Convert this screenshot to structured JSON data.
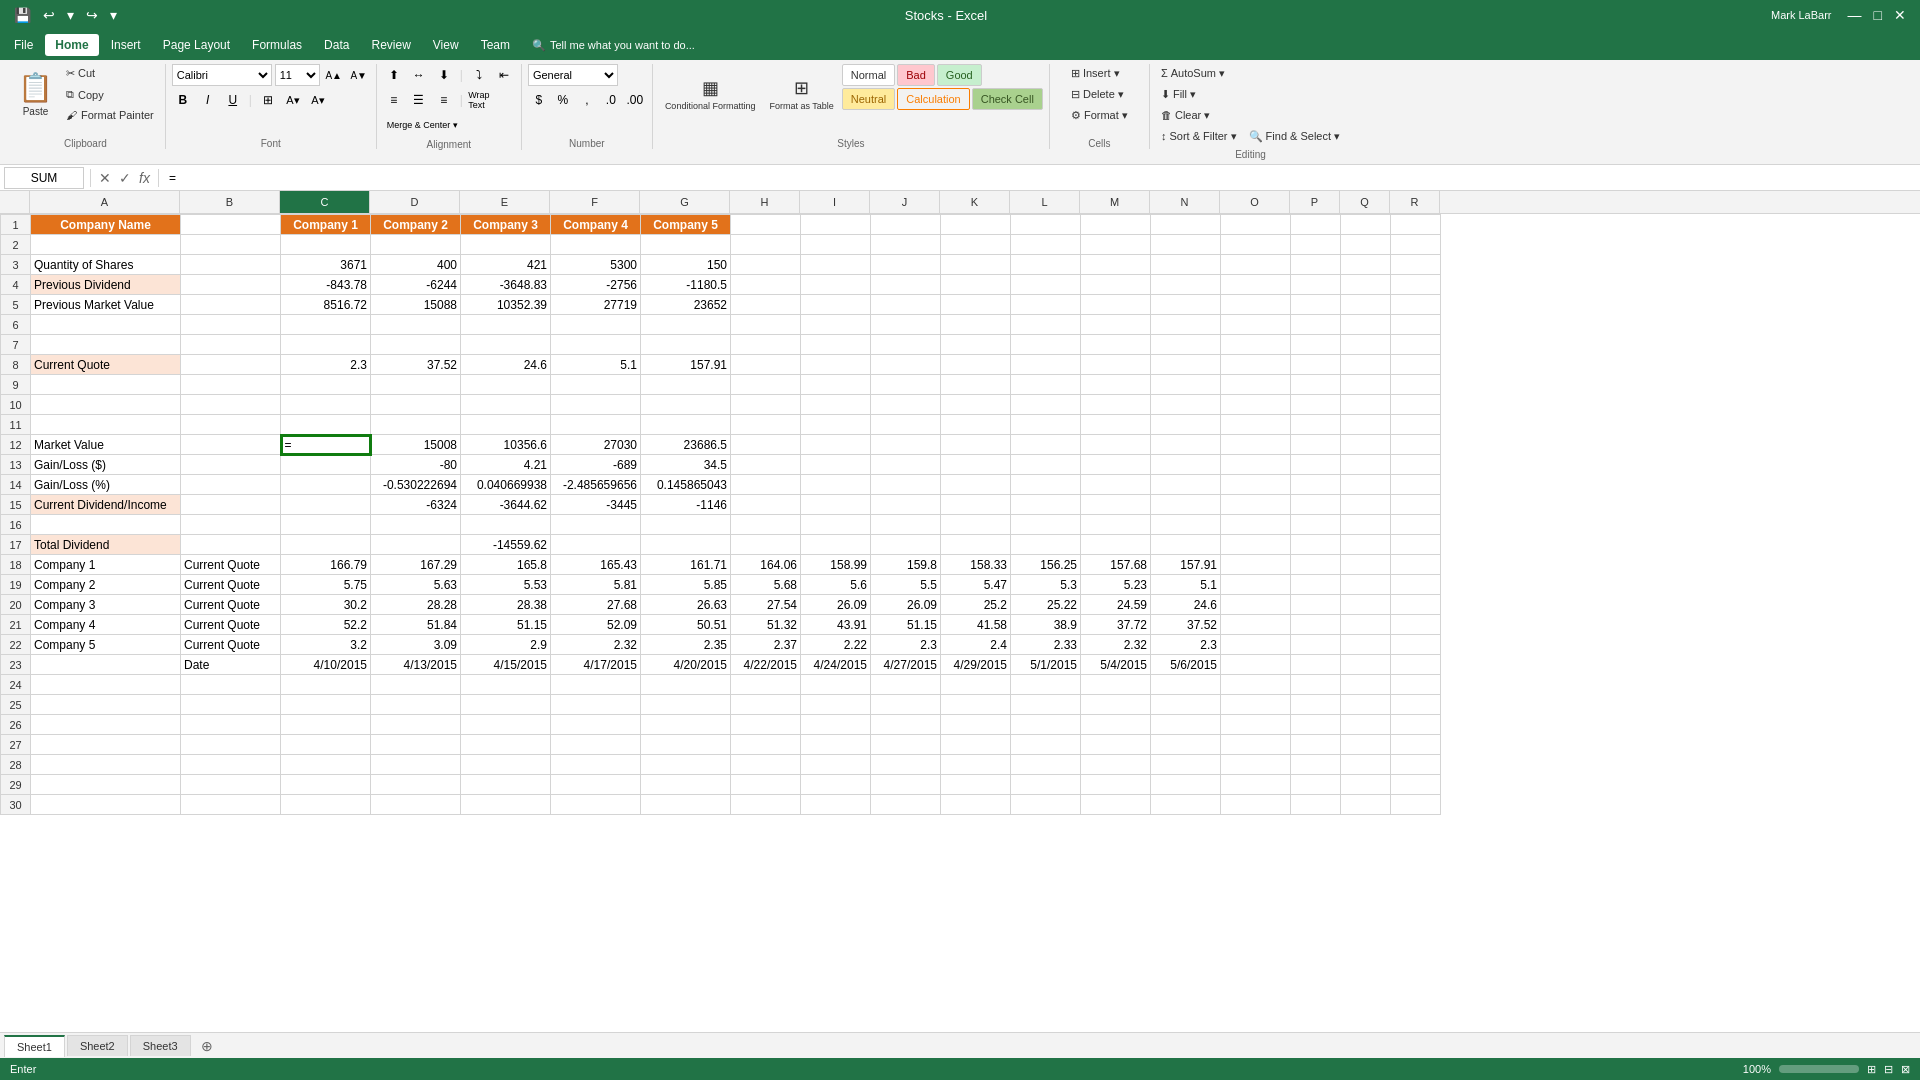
{
  "app": {
    "title": "Stocks - Excel",
    "user": "Mark LaBarr"
  },
  "titlebar": {
    "save_icon": "💾",
    "undo_icon": "↩",
    "redo_icon": "↪",
    "minimize": "—",
    "maximize": "□",
    "close": "✕"
  },
  "menu": {
    "items": [
      "File",
      "Home",
      "Insert",
      "Page Layout",
      "Formulas",
      "Data",
      "Review",
      "View",
      "Team"
    ]
  },
  "ribbon": {
    "clipboard": {
      "label": "Clipboard",
      "paste_label": "Paste",
      "cut_label": "Cut",
      "copy_label": "Copy",
      "format_painter_label": "Format Painter"
    },
    "font": {
      "label": "Font",
      "font_name": "Calibri",
      "font_size": "11",
      "bold": "B",
      "italic": "I",
      "underline": "U"
    },
    "alignment": {
      "label": "Alignment",
      "wrap_text": "Wrap Text",
      "merge_center": "Merge & Center"
    },
    "number": {
      "label": "Number",
      "format": "General"
    },
    "styles": {
      "label": "Styles",
      "conditional_formatting": "Conditional Formatting",
      "format_as_table": "Format as Table",
      "normal": "Normal",
      "bad": "Bad",
      "good": "Good",
      "neutral": "Neutral",
      "calculation": "Calculation",
      "check_cell": "Check Cell"
    },
    "cells": {
      "label": "Cells",
      "insert": "Insert",
      "delete": "Delete",
      "format": "Format"
    },
    "editing": {
      "label": "Editing",
      "autosum": "AutoSum",
      "fill": "Fill",
      "clear": "Clear",
      "sort_filter": "Sort & Filter",
      "find_select": "Find & Select"
    }
  },
  "formula_bar": {
    "cell_name": "SUM",
    "formula": "="
  },
  "col_headers": [
    "A",
    "B",
    "C",
    "D",
    "E",
    "F",
    "G",
    "H",
    "I",
    "J",
    "K",
    "L",
    "M",
    "N",
    "O",
    "P",
    "Q",
    "R"
  ],
  "rows": [
    {
      "row": 1,
      "cells": [
        "Company Name",
        "",
        "Company 1",
        "Company 2",
        "Company 3",
        "Company 4",
        "Company 5",
        "",
        "",
        "",
        "",
        "",
        "",
        "",
        "",
        "",
        "",
        ""
      ]
    },
    {
      "row": 2,
      "cells": [
        "",
        "",
        "",
        "",
        "",
        "",
        "",
        "",
        "",
        "",
        "",
        "",
        "",
        "",
        "",
        "",
        "",
        ""
      ]
    },
    {
      "row": 3,
      "cells": [
        "Quantity of Shares",
        "",
        "3671",
        "400",
        "421",
        "5300",
        "150",
        "",
        "",
        "",
        "",
        "",
        "",
        "",
        "",
        "",
        "",
        ""
      ]
    },
    {
      "row": 4,
      "cells": [
        "Previous Dividend",
        "",
        "-843.78",
        "-6244",
        "-3648.83",
        "-2756",
        "-1180.5",
        "",
        "",
        "",
        "",
        "",
        "",
        "",
        "",
        "",
        "",
        ""
      ]
    },
    {
      "row": 5,
      "cells": [
        "Previous Market Value",
        "",
        "8516.72",
        "15088",
        "10352.39",
        "27719",
        "23652",
        "",
        "",
        "",
        "",
        "",
        "",
        "",
        "",
        "",
        "",
        ""
      ]
    },
    {
      "row": 6,
      "cells": [
        "",
        "",
        "",
        "",
        "",
        "",
        "",
        "",
        "",
        "",
        "",
        "",
        "",
        "",
        "",
        "",
        "",
        ""
      ]
    },
    {
      "row": 7,
      "cells": [
        "",
        "",
        "",
        "",
        "",
        "",
        "",
        "",
        "",
        "",
        "",
        "",
        "",
        "",
        "",
        "",
        "",
        ""
      ]
    },
    {
      "row": 8,
      "cells": [
        "Current Quote",
        "",
        "2.3",
        "37.52",
        "24.6",
        "5.1",
        "157.91",
        "",
        "",
        "",
        "",
        "",
        "",
        "",
        "",
        "",
        "",
        ""
      ]
    },
    {
      "row": 9,
      "cells": [
        "",
        "",
        "",
        "",
        "",
        "",
        "",
        "",
        "",
        "",
        "",
        "",
        "",
        "",
        "",
        "",
        "",
        ""
      ]
    },
    {
      "row": 10,
      "cells": [
        "",
        "",
        "",
        "",
        "",
        "",
        "",
        "",
        "",
        "",
        "",
        "",
        "",
        "",
        "",
        "",
        "",
        ""
      ]
    },
    {
      "row": 11,
      "cells": [
        "",
        "",
        "",
        "",
        "",
        "",
        "",
        "",
        "",
        "",
        "",
        "",
        "",
        "",
        "",
        "",
        "",
        ""
      ]
    },
    {
      "row": 12,
      "cells": [
        "Market Value",
        "",
        "=",
        "15008",
        "10356.6",
        "27030",
        "23686.5",
        "",
        "",
        "",
        "",
        "",
        "",
        "",
        "",
        "",
        "",
        ""
      ]
    },
    {
      "row": 13,
      "cells": [
        "Gain/Loss ($)",
        "",
        "",
        "-80",
        "4.21",
        "-689",
        "34.5",
        "",
        "",
        "",
        "",
        "",
        "",
        "",
        "",
        "",
        "",
        ""
      ]
    },
    {
      "row": 14,
      "cells": [
        "Gain/Loss (%)",
        "",
        "",
        "-0.530222694",
        "0.040669938",
        "-2.485659656",
        "0.145865043",
        "",
        "",
        "",
        "",
        "",
        "",
        "",
        "",
        "",
        "",
        ""
      ]
    },
    {
      "row": 15,
      "cells": [
        "Current Dividend/Income",
        "",
        "",
        "-6324",
        "-3644.62",
        "-3445",
        "-1146",
        "",
        "",
        "",
        "",
        "",
        "",
        "",
        "",
        "",
        "",
        ""
      ]
    },
    {
      "row": 16,
      "cells": [
        "",
        "",
        "",
        "",
        "",
        "",
        "",
        "",
        "",
        "",
        "",
        "",
        "",
        "",
        "",
        "",
        "",
        ""
      ]
    },
    {
      "row": 17,
      "cells": [
        "Total Dividend",
        "",
        "",
        "",
        "-14559.62",
        "",
        "",
        "",
        "",
        "",
        "",
        "",
        "",
        "",
        "",
        "",
        "",
        ""
      ]
    },
    {
      "row": 18,
      "cells": [
        "Company 1",
        "Current Quote",
        "166.79",
        "167.29",
        "165.8",
        "165.43",
        "161.71",
        "164.06",
        "158.99",
        "159.8",
        "158.33",
        "156.25",
        "157.68",
        "157.91",
        "",
        "",
        "",
        ""
      ]
    },
    {
      "row": 19,
      "cells": [
        "Company 2",
        "Current Quote",
        "5.75",
        "5.63",
        "5.53",
        "5.81",
        "5.85",
        "5.68",
        "5.6",
        "5.5",
        "5.47",
        "5.3",
        "5.23",
        "5.1",
        "",
        "",
        "",
        ""
      ]
    },
    {
      "row": 20,
      "cells": [
        "Company 3",
        "Current Quote",
        "30.2",
        "28.28",
        "28.38",
        "27.68",
        "26.63",
        "27.54",
        "26.09",
        "26.09",
        "25.2",
        "25.22",
        "24.59",
        "24.6",
        "",
        "",
        "",
        ""
      ]
    },
    {
      "row": 21,
      "cells": [
        "Company 4",
        "Current Quote",
        "52.2",
        "51.84",
        "51.15",
        "52.09",
        "50.51",
        "51.32",
        "43.91",
        "51.15",
        "41.58",
        "38.9",
        "37.72",
        "37.52",
        "",
        "",
        "",
        ""
      ]
    },
    {
      "row": 22,
      "cells": [
        "Company 5",
        "Current Quote",
        "3.2",
        "3.09",
        "2.9",
        "2.32",
        "2.35",
        "2.37",
        "2.22",
        "2.3",
        "2.4",
        "2.33",
        "2.32",
        "2.3",
        "",
        "",
        "",
        ""
      ]
    },
    {
      "row": 23,
      "cells": [
        "",
        "Date",
        "4/10/2015",
        "4/13/2015",
        "4/15/2015",
        "4/17/2015",
        "4/20/2015",
        "4/22/2015",
        "4/24/2015",
        "4/27/2015",
        "4/29/2015",
        "5/1/2015",
        "5/4/2015",
        "5/6/2015",
        "",
        "",
        "",
        ""
      ]
    },
    {
      "row": 24,
      "cells": [
        "",
        "",
        "",
        "",
        "",
        "",
        "",
        "",
        "",
        "",
        "",
        "",
        "",
        "",
        "",
        "",
        "",
        ""
      ]
    },
    {
      "row": 25,
      "cells": [
        "",
        "",
        "",
        "",
        "",
        "",
        "",
        "",
        "",
        "",
        "",
        "",
        "",
        "",
        "",
        "",
        "",
        ""
      ]
    },
    {
      "row": 26,
      "cells": [
        "",
        "",
        "",
        "",
        "",
        "",
        "",
        "",
        "",
        "",
        "",
        "",
        "",
        "",
        "",
        "",
        "",
        ""
      ]
    },
    {
      "row": 27,
      "cells": [
        "",
        "",
        "",
        "",
        "",
        "",
        "",
        "",
        "",
        "",
        "",
        "",
        "",
        "",
        "",
        "",
        "",
        ""
      ]
    },
    {
      "row": 28,
      "cells": [
        "",
        "",
        "",
        "",
        "",
        "",
        "",
        "",
        "",
        "",
        "",
        "",
        "",
        "",
        "",
        "",
        "",
        ""
      ]
    },
    {
      "row": 29,
      "cells": [
        "",
        "",
        "",
        "",
        "",
        "",
        "",
        "",
        "",
        "",
        "",
        "",
        "",
        "",
        "",
        "",
        "",
        ""
      ]
    },
    {
      "row": 30,
      "cells": [
        "",
        "",
        "",
        "",
        "",
        "",
        "",
        "",
        "",
        "",
        "",
        "",
        "",
        "",
        "",
        "",
        "",
        ""
      ]
    }
  ],
  "sheets": [
    "Sheet1",
    "Sheet2",
    "Sheet3"
  ],
  "active_sheet": "Sheet1",
  "status": {
    "left": "Enter",
    "right_icons": [
      "sheet-normal",
      "sheet-page-layout",
      "sheet-page-break"
    ]
  },
  "active_cell": {
    "row": 12,
    "col": "C"
  }
}
